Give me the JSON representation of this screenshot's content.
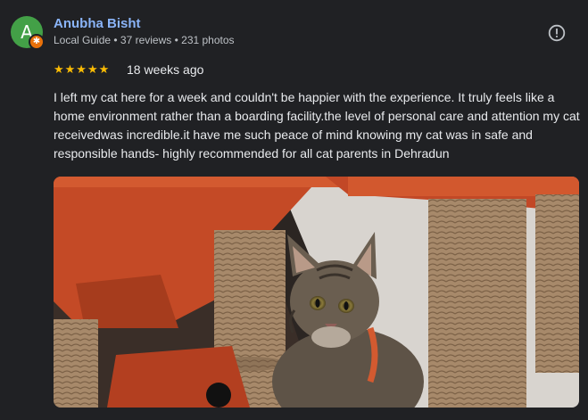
{
  "reviewer": {
    "avatar_letter": "A",
    "name": "Anubha Bisht",
    "meta": "Local Guide • 37 reviews • 231 photos",
    "badge_icon": "local-guide-badge-icon",
    "avatar_color": "#43a047",
    "badge_color": "#e8710a"
  },
  "review": {
    "rating": 5,
    "stars": "★★★★★",
    "date": "18 weeks ago",
    "text": "I left my cat here for a week and couldn't be happier with the experience. It truly feels like a home environment rather than a boarding facility.the level of personal care and attention my cat receivedwas incredible.it have me such peace of mind knowing my cat was in safe and responsible hands- highly recommended for all cat parents in Dehradun"
  },
  "actions": {
    "more_icon": "report-icon"
  },
  "colors": {
    "name_link": "#8ab4f8",
    "star": "#fbbc04",
    "background": "#202124"
  }
}
